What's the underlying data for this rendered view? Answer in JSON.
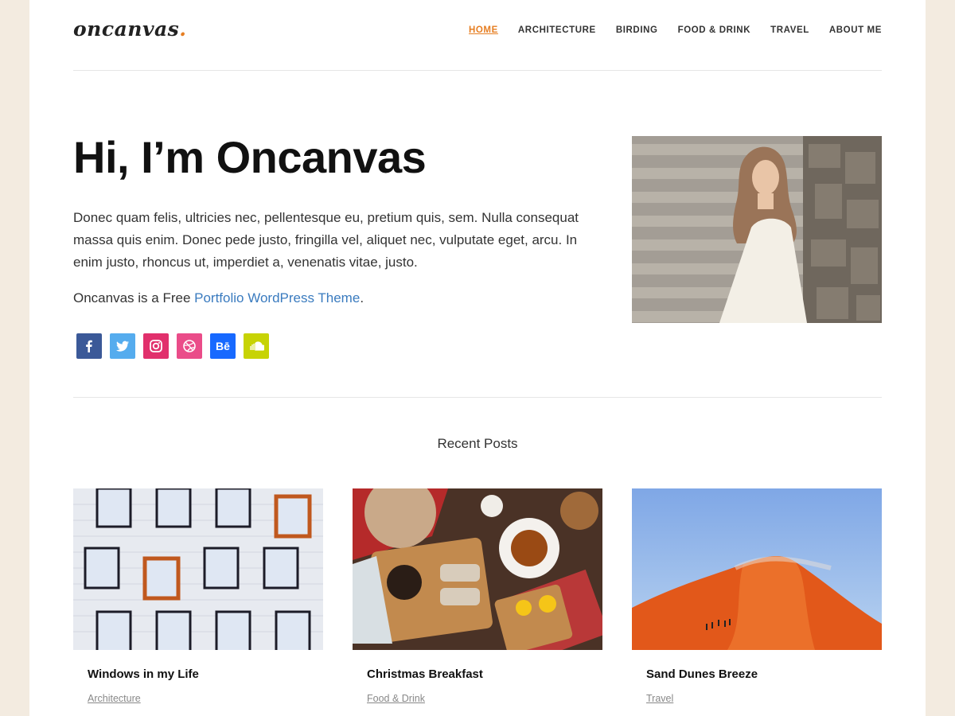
{
  "site": {
    "logo": "oncanvas",
    "logo_dot": ".",
    "accent_color": "#e67e22"
  },
  "nav": {
    "items": [
      {
        "label": "HOME",
        "active": true
      },
      {
        "label": "ARCHITECTURE"
      },
      {
        "label": "BIRDING"
      },
      {
        "label": "FOOD & DRINK"
      },
      {
        "label": "TRAVEL"
      },
      {
        "label": "ABOUT ME"
      }
    ]
  },
  "hero": {
    "title": "Hi, I’m Oncanvas",
    "paragraph": "Donec quam felis, ultricies nec, pellentesque eu, pretium quis, sem. Nulla consequat massa quis enim. Donec pede justo, fringilla vel, aliquet nec, vulputate eget, arcu. In enim justo, rhoncus ut, imperdiet a, venenatis vitae, justo.",
    "line2_prefix": "Oncanvas is a Free ",
    "line2_link": "Portfolio WordPress Theme",
    "line2_suffix": "."
  },
  "socials": [
    {
      "name": "facebook-icon",
      "glyph": "f",
      "color": "#3b5998"
    },
    {
      "name": "twitter-icon",
      "glyph": "t",
      "color": "#55acee"
    },
    {
      "name": "instagram-icon",
      "glyph": "◎",
      "color": "#e1306c"
    },
    {
      "name": "dribbble-icon",
      "glyph": "◍",
      "color": "#ea4c89"
    },
    {
      "name": "behance-icon",
      "glyph": "Bē",
      "color": "#1769ff"
    },
    {
      "name": "soundcloud-icon",
      "glyph": "☁",
      "color": "#c7d305"
    }
  ],
  "recent": {
    "title": "Recent Posts",
    "posts": [
      {
        "title": "Windows in my Life",
        "category": "Architecture"
      },
      {
        "title": "Christmas Breakfast",
        "category": "Food & Drink"
      },
      {
        "title": "Sand Dunes Breeze",
        "category": "Travel"
      }
    ]
  }
}
